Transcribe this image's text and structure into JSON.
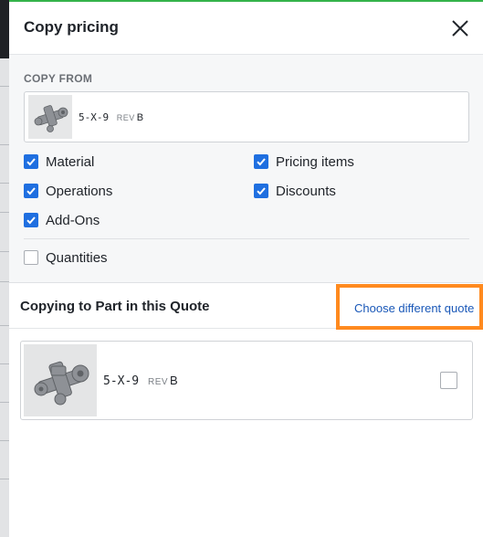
{
  "header": {
    "title": "Copy pricing",
    "close_icon": "close-icon"
  },
  "copy_from": {
    "label": "COPY FROM",
    "part": {
      "name": "5-X-9",
      "rev_label": "REV",
      "rev_value": "B",
      "thumbnail": "part-thumbnail"
    }
  },
  "options": [
    {
      "label": "Material",
      "checked": true
    },
    {
      "label": "Pricing items",
      "checked": true
    },
    {
      "label": "Operations",
      "checked": true
    },
    {
      "label": "Discounts",
      "checked": true
    },
    {
      "label": "Add-Ons",
      "checked": true
    },
    {
      "label": "Quantities",
      "checked": false
    }
  ],
  "copy_to": {
    "title": "Copying to Part in this Quote",
    "choose_link": "Choose different quote",
    "part": {
      "name": "5-X-9",
      "rev_label": "REV",
      "rev_value": "B",
      "checked": false
    }
  },
  "colors": {
    "accent": "#1f6fe0",
    "link": "#1a58b8",
    "highlight": "#ff8a1f",
    "top_bar": "#34b34a"
  }
}
